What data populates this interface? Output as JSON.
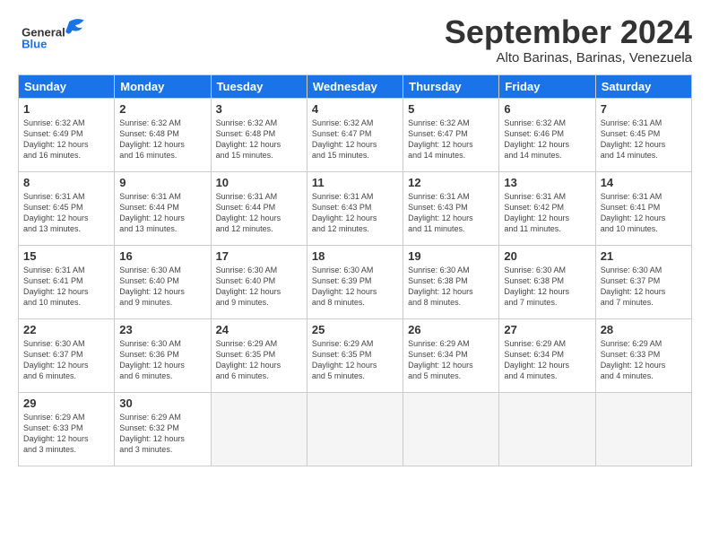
{
  "header": {
    "logo_general": "General",
    "logo_blue": "Blue",
    "month_title": "September 2024",
    "subtitle": "Alto Barinas, Barinas, Venezuela"
  },
  "weekdays": [
    "Sunday",
    "Monday",
    "Tuesday",
    "Wednesday",
    "Thursday",
    "Friday",
    "Saturday"
  ],
  "weeks": [
    [
      {
        "day": "1",
        "info": "Sunrise: 6:32 AM\nSunset: 6:49 PM\nDaylight: 12 hours\nand 16 minutes."
      },
      {
        "day": "2",
        "info": "Sunrise: 6:32 AM\nSunset: 6:48 PM\nDaylight: 12 hours\nand 16 minutes."
      },
      {
        "day": "3",
        "info": "Sunrise: 6:32 AM\nSunset: 6:48 PM\nDaylight: 12 hours\nand 15 minutes."
      },
      {
        "day": "4",
        "info": "Sunrise: 6:32 AM\nSunset: 6:47 PM\nDaylight: 12 hours\nand 15 minutes."
      },
      {
        "day": "5",
        "info": "Sunrise: 6:32 AM\nSunset: 6:47 PM\nDaylight: 12 hours\nand 14 minutes."
      },
      {
        "day": "6",
        "info": "Sunrise: 6:32 AM\nSunset: 6:46 PM\nDaylight: 12 hours\nand 14 minutes."
      },
      {
        "day": "7",
        "info": "Sunrise: 6:31 AM\nSunset: 6:45 PM\nDaylight: 12 hours\nand 14 minutes."
      }
    ],
    [
      {
        "day": "8",
        "info": "Sunrise: 6:31 AM\nSunset: 6:45 PM\nDaylight: 12 hours\nand 13 minutes."
      },
      {
        "day": "9",
        "info": "Sunrise: 6:31 AM\nSunset: 6:44 PM\nDaylight: 12 hours\nand 13 minutes."
      },
      {
        "day": "10",
        "info": "Sunrise: 6:31 AM\nSunset: 6:44 PM\nDaylight: 12 hours\nand 12 minutes."
      },
      {
        "day": "11",
        "info": "Sunrise: 6:31 AM\nSunset: 6:43 PM\nDaylight: 12 hours\nand 12 minutes."
      },
      {
        "day": "12",
        "info": "Sunrise: 6:31 AM\nSunset: 6:43 PM\nDaylight: 12 hours\nand 11 minutes."
      },
      {
        "day": "13",
        "info": "Sunrise: 6:31 AM\nSunset: 6:42 PM\nDaylight: 12 hours\nand 11 minutes."
      },
      {
        "day": "14",
        "info": "Sunrise: 6:31 AM\nSunset: 6:41 PM\nDaylight: 12 hours\nand 10 minutes."
      }
    ],
    [
      {
        "day": "15",
        "info": "Sunrise: 6:31 AM\nSunset: 6:41 PM\nDaylight: 12 hours\nand 10 minutes."
      },
      {
        "day": "16",
        "info": "Sunrise: 6:30 AM\nSunset: 6:40 PM\nDaylight: 12 hours\nand 9 minutes."
      },
      {
        "day": "17",
        "info": "Sunrise: 6:30 AM\nSunset: 6:40 PM\nDaylight: 12 hours\nand 9 minutes."
      },
      {
        "day": "18",
        "info": "Sunrise: 6:30 AM\nSunset: 6:39 PM\nDaylight: 12 hours\nand 8 minutes."
      },
      {
        "day": "19",
        "info": "Sunrise: 6:30 AM\nSunset: 6:38 PM\nDaylight: 12 hours\nand 8 minutes."
      },
      {
        "day": "20",
        "info": "Sunrise: 6:30 AM\nSunset: 6:38 PM\nDaylight: 12 hours\nand 7 minutes."
      },
      {
        "day": "21",
        "info": "Sunrise: 6:30 AM\nSunset: 6:37 PM\nDaylight: 12 hours\nand 7 minutes."
      }
    ],
    [
      {
        "day": "22",
        "info": "Sunrise: 6:30 AM\nSunset: 6:37 PM\nDaylight: 12 hours\nand 6 minutes."
      },
      {
        "day": "23",
        "info": "Sunrise: 6:30 AM\nSunset: 6:36 PM\nDaylight: 12 hours\nand 6 minutes."
      },
      {
        "day": "24",
        "info": "Sunrise: 6:29 AM\nSunset: 6:35 PM\nDaylight: 12 hours\nand 6 minutes."
      },
      {
        "day": "25",
        "info": "Sunrise: 6:29 AM\nSunset: 6:35 PM\nDaylight: 12 hours\nand 5 minutes."
      },
      {
        "day": "26",
        "info": "Sunrise: 6:29 AM\nSunset: 6:34 PM\nDaylight: 12 hours\nand 5 minutes."
      },
      {
        "day": "27",
        "info": "Sunrise: 6:29 AM\nSunset: 6:34 PM\nDaylight: 12 hours\nand 4 minutes."
      },
      {
        "day": "28",
        "info": "Sunrise: 6:29 AM\nSunset: 6:33 PM\nDaylight: 12 hours\nand 4 minutes."
      }
    ],
    [
      {
        "day": "29",
        "info": "Sunrise: 6:29 AM\nSunset: 6:33 PM\nDaylight: 12 hours\nand 3 minutes."
      },
      {
        "day": "30",
        "info": "Sunrise: 6:29 AM\nSunset: 6:32 PM\nDaylight: 12 hours\nand 3 minutes."
      },
      null,
      null,
      null,
      null,
      null
    ]
  ]
}
